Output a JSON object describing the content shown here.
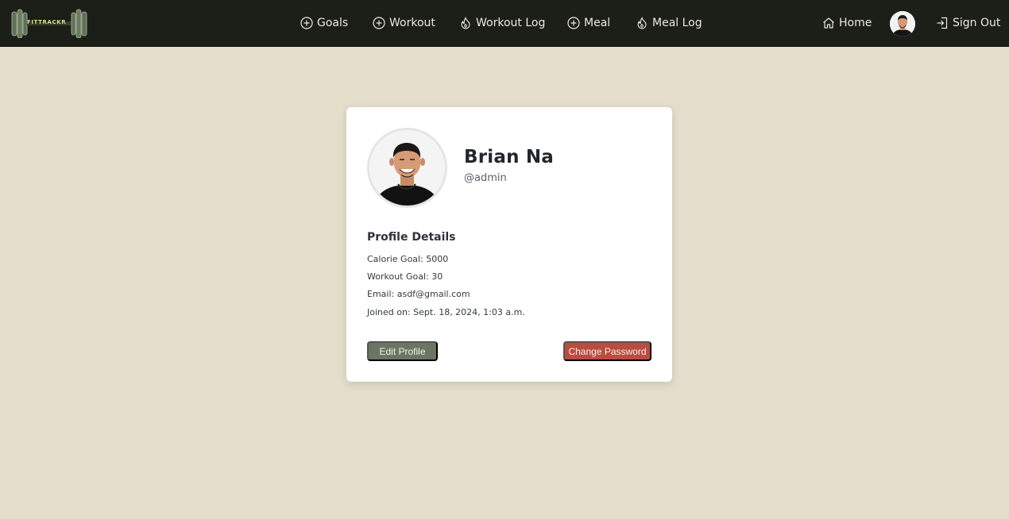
{
  "navbar": {
    "logo_text": "FITTRACKR",
    "links": [
      {
        "label": "Goals",
        "icon": "plus-circle-icon"
      },
      {
        "label": "Workout",
        "icon": "plus-circle-icon"
      },
      {
        "label": "Workout Log",
        "icon": "flame-icon"
      },
      {
        "label": "Meal",
        "icon": "plus-circle-icon"
      },
      {
        "label": "Meal Log",
        "icon": "flame-icon"
      }
    ],
    "home_label": "Home",
    "signout_label": "Sign Out"
  },
  "profile": {
    "name": "Brian Na",
    "handle": "@admin",
    "section_title": "Profile Details",
    "details": [
      "Calorie Goal: 5000",
      "Workout Goal: 30",
      "Email: asdf@gmail.com",
      "Joined on: Sept. 18, 2024, 1:03 a.m."
    ],
    "edit_button": "Edit Profile",
    "change_password_button": "Change Password"
  },
  "colors": {
    "page_bg": "#e3ddca",
    "nav_bg": "#1c1e18",
    "edit_btn": "#6a7563",
    "password_btn": "#ba4c42"
  }
}
